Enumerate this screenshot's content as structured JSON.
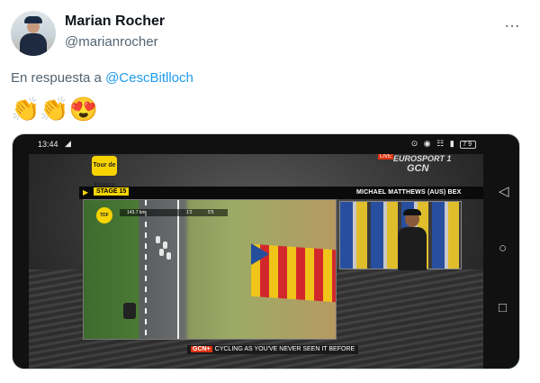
{
  "tweet": {
    "author_name": "Marian Rocher",
    "author_handle": "@marianrocher",
    "more_icon": "…",
    "reply_prefix": "En respuesta a ",
    "reply_mention": "@CescBitlloch",
    "emojis": "👏👏😍"
  },
  "media": {
    "status_time": "13:44",
    "status_right": "⊙ ◉ ☷ ▮",
    "battery": "79",
    "broadcast": {
      "logo_text": "Tour de France",
      "live_label": "LIVE",
      "eurosport": "EUROSPORT 1",
      "gcn": "GCN",
      "stage_label": "STAGE 15",
      "rider_name": "MICHAEL MATTHEWS (AUS) BEX",
      "race_distance": "143.7 km",
      "race_gap": "1'2",
      "race_time": "5'5",
      "tagline_badge": "GCN+",
      "tagline_text": "CYCLING AS YOU'VE NEVER SEEN IT BEFORE"
    },
    "nav_icons": {
      "back": "◁",
      "home": "○",
      "recent": "□"
    }
  }
}
